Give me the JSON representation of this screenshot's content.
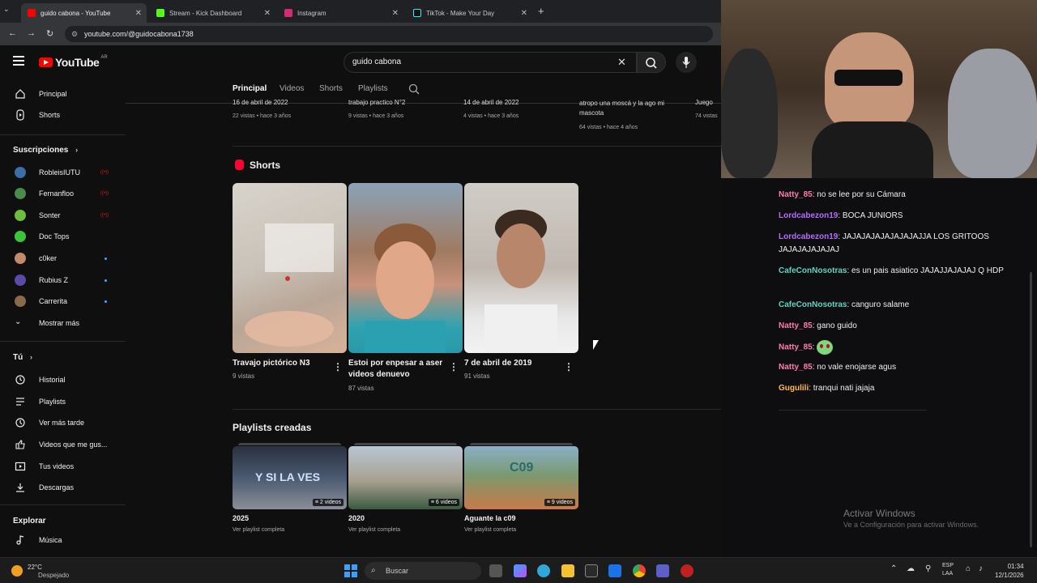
{
  "browser": {
    "tabs": [
      {
        "title": "guido cabona - YouTube",
        "color": "#ff0000"
      },
      {
        "title": "Stream - Kick Dashboard",
        "color": "#53fc18"
      },
      {
        "title": "Instagram",
        "color": "#d62976"
      },
      {
        "title": "TikTok - Make Your Day",
        "color": "#25f4ee"
      }
    ],
    "url": "youtube.com/@guidocabona1738"
  },
  "youtube": {
    "logo_text": "YouTube",
    "country": "AR",
    "search_value": "guido cabona",
    "channel_tabs": [
      "Principal",
      "Videos",
      "Shorts",
      "Playlists"
    ]
  },
  "sidebar": {
    "main": [
      {
        "label": "Principal",
        "icon": "home-icon"
      },
      {
        "label": "Shorts",
        "icon": "shorts-icon"
      }
    ],
    "subscriptions_header": "Suscripciones",
    "subscriptions": [
      {
        "label": "RobleisIUTU",
        "status": "live",
        "color": "#3a6ea5"
      },
      {
        "label": "Fernanfloo",
        "status": "live",
        "color": "#4a8a4a"
      },
      {
        "label": "Sonter",
        "status": "live",
        "color": "#6bbf3a"
      },
      {
        "label": "Doc Tops",
        "status": "",
        "color": "#39c639"
      },
      {
        "label": "c0ker",
        "status": "new",
        "color": "#c28a6a"
      },
      {
        "label": "Rubius Z",
        "status": "new",
        "color": "#5b4aa8"
      },
      {
        "label": "Carrerita",
        "status": "new",
        "color": "#8a6a4a"
      }
    ],
    "show_more": "Mostrar más",
    "you_header": "Tú",
    "you_items": [
      {
        "label": "Historial",
        "icon": "history-icon"
      },
      {
        "label": "Playlists",
        "icon": "playlists-icon"
      },
      {
        "label": "Ver más tarde",
        "icon": "watch-later-icon"
      },
      {
        "label": "Videos que me gus...",
        "icon": "like-icon"
      },
      {
        "label": "Tus videos",
        "icon": "your-videos-icon"
      },
      {
        "label": "Descargas",
        "icon": "download-icon"
      }
    ],
    "explore_header": "Explorar",
    "explore_items": [
      {
        "label": "Música",
        "icon": "music-icon"
      }
    ]
  },
  "previous_row": [
    {
      "title": "16 de abril de 2022",
      "meta": "22 vistas • hace 3 años"
    },
    {
      "title": "trabajo practico N°2",
      "meta": "9 vistas • hace 3 años"
    },
    {
      "title": "14 de abril de 2022",
      "meta": "4 vistas • hace 3 años"
    },
    {
      "title": "atropo una moscá y la ago mi mascota",
      "meta": "64 vistas • hace 4 años"
    },
    {
      "title": "Juego",
      "meta": "74 vistas"
    }
  ],
  "shorts": {
    "title": "Shorts",
    "items": [
      {
        "title": "Travajo pictórico N3",
        "views": "9 vistas"
      },
      {
        "title": "Estoi por enpesar a aser videos denuevo",
        "views": "87 vistas"
      },
      {
        "title": "7 de abril de 2019",
        "views": "91 vistas"
      }
    ]
  },
  "playlists": {
    "title": "Playlists creadas",
    "items": [
      {
        "name": "2025",
        "count": "2 videos",
        "link": "Ver playlist completa",
        "thumb_text": "Y SI LA VES"
      },
      {
        "name": "2020",
        "count": "6 videos",
        "link": "Ver playlist completa",
        "thumb_text": ""
      },
      {
        "name": "Aguante la c09",
        "count": "9 videos",
        "link": "Ver playlist completa",
        "thumb_text": "C09"
      }
    ]
  },
  "chat": {
    "messages": [
      {
        "user": "Natty_85",
        "text": " no se lee por su Cámara",
        "color": "#ff7bac"
      },
      {
        "user": "Lordcabezon19",
        "text": " BOCA JUNIORS",
        "color": "#b56bff"
      },
      {
        "user": "Lordcabezon19",
        "text": " JAJAJAJAJAJAJAJAJJA LOS GRITOOS JAJAJAJAJAJAJ",
        "color": "#b56bff"
      },
      {
        "user": "CafeConNosotras",
        "text": " es un pais asiatico JAJAJJAJAJAJ Q HDP",
        "color": "#5cd6c0"
      },
      {
        "user": "CafeConNosotras",
        "text": " canguro salame",
        "color": "#5cd6c0"
      },
      {
        "user": "Natty_85",
        "text": " gano guido",
        "color": "#ff7bac"
      },
      {
        "user": "Natty_85",
        "text": " ",
        "color": "#ff7bac"
      },
      {
        "user": "Natty_85",
        "text": " no vale enojarse agus",
        "color": "#ff7bac"
      },
      {
        "user": "Gugulili",
        "text": " tranqui nati jajaja",
        "color": "#ffb84d"
      }
    ]
  },
  "windows": {
    "activate_title": "Activar Windows",
    "activate_sub": "Ve a Configuración para activar Windows."
  },
  "taskbar": {
    "search_placeholder": "Buscar",
    "weather_temp": "22°C",
    "weather_cond": "Despejado",
    "lang_1": "ESP",
    "lang_2": "LAA",
    "time": "01:34",
    "date": "12/1/2026"
  }
}
